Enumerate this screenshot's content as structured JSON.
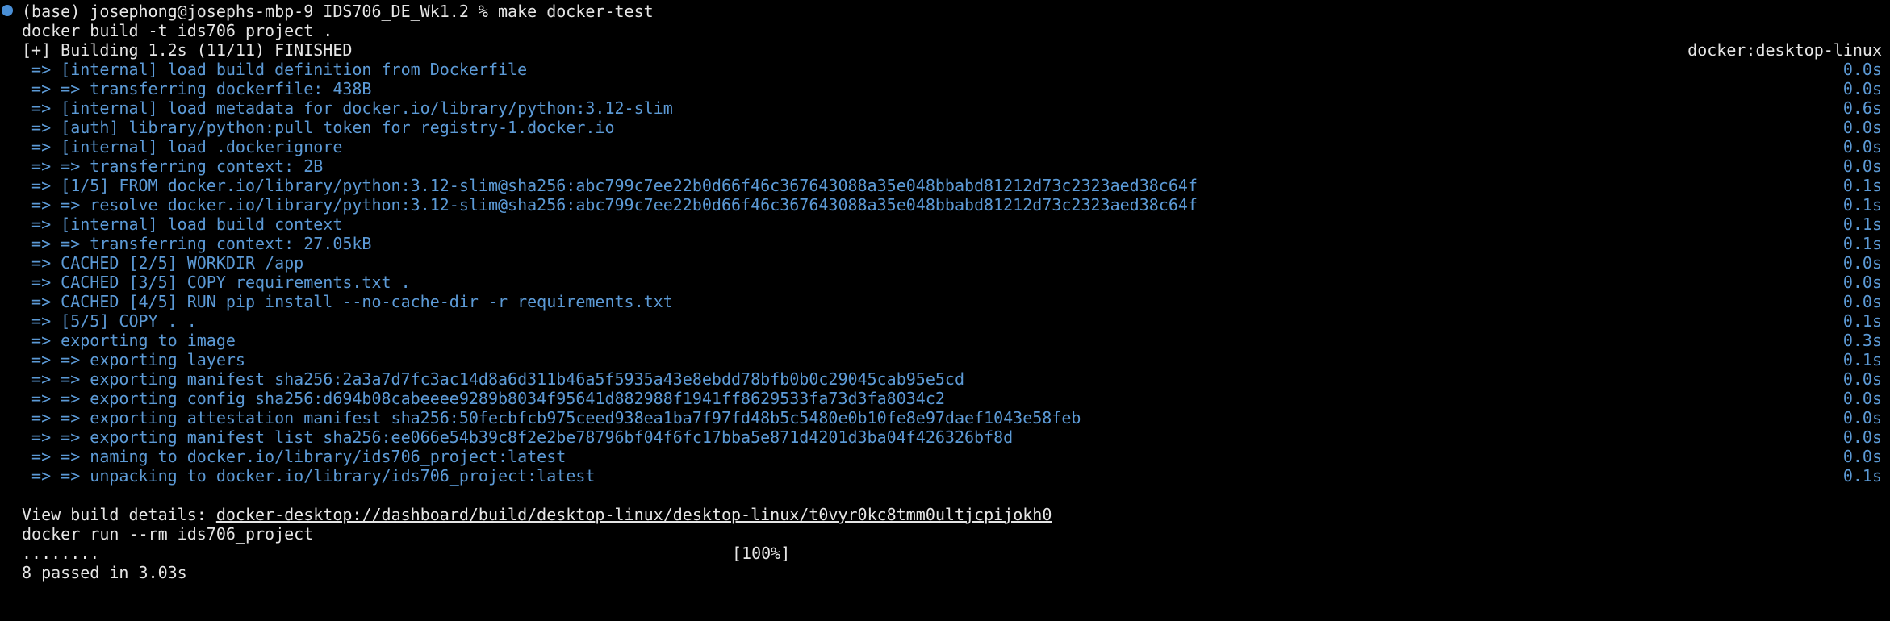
{
  "terminal": {
    "prompt": "(base) josephong@josephs-mbp-9 IDS706_DE_Wk1.2 % make docker-test",
    "build_cmd": "docker build -t ids706_project .",
    "building": "[+] Building 1.2s (11/11) FINISHED",
    "builder": "docker:desktop-linux",
    "steps": [
      {
        "text": " => [internal] load build definition from Dockerfile",
        "time": "0.0s"
      },
      {
        "text": " => => transferring dockerfile: 438B",
        "time": "0.0s"
      },
      {
        "text": " => [internal] load metadata for docker.io/library/python:3.12-slim",
        "time": "0.6s"
      },
      {
        "text": " => [auth] library/python:pull token for registry-1.docker.io",
        "time": "0.0s"
      },
      {
        "text": " => [internal] load .dockerignore",
        "time": "0.0s"
      },
      {
        "text": " => => transferring context: 2B",
        "time": "0.0s"
      },
      {
        "text": " => [1/5] FROM docker.io/library/python:3.12-slim@sha256:abc799c7ee22b0d66f46c367643088a35e048bbabd81212d73c2323aed38c64f",
        "time": "0.1s"
      },
      {
        "text": " => => resolve docker.io/library/python:3.12-slim@sha256:abc799c7ee22b0d66f46c367643088a35e048bbabd81212d73c2323aed38c64f",
        "time": "0.1s"
      },
      {
        "text": " => [internal] load build context",
        "time": "0.1s"
      },
      {
        "text": " => => transferring context: 27.05kB",
        "time": "0.1s"
      },
      {
        "text": " => CACHED [2/5] WORKDIR /app",
        "time": "0.0s"
      },
      {
        "text": " => CACHED [3/5] COPY requirements.txt .",
        "time": "0.0s"
      },
      {
        "text": " => CACHED [4/5] RUN pip install --no-cache-dir -r requirements.txt",
        "time": "0.0s"
      },
      {
        "text": " => [5/5] COPY . .",
        "time": "0.1s"
      },
      {
        "text": " => exporting to image",
        "time": "0.3s"
      },
      {
        "text": " => => exporting layers",
        "time": "0.1s"
      },
      {
        "text": " => => exporting manifest sha256:2a3a7d7fc3ac14d8a6d311b46a5f5935a43e8ebdd78bfb0b0c29045cab95e5cd",
        "time": "0.0s"
      },
      {
        "text": " => => exporting config sha256:d694b08cabeeee9289b8034f95641d882988f1941ff8629533fa73d3fa8034c2",
        "time": "0.0s"
      },
      {
        "text": " => => exporting attestation manifest sha256:50fecbfcb975ceed938ea1ba7f97fd48b5c5480e0b10fe8e97daef1043e58feb",
        "time": "0.0s"
      },
      {
        "text": " => => exporting manifest list sha256:ee066e54b39c8f2e2be78796bf04f6fc17bba5e871d4201d3ba04f426326bf8d",
        "time": "0.0s"
      },
      {
        "text": " => => naming to docker.io/library/ids706_project:latest",
        "time": "0.0s"
      },
      {
        "text": " => => unpacking to docker.io/library/ids706_project:latest",
        "time": "0.1s"
      }
    ],
    "view_label": "View build details: ",
    "view_link": "docker-desktop://dashboard/build/desktop-linux/desktop-linux/t0vyr0kc8tmm0ultjcpijokh0",
    "run_cmd": "docker run --rm ids706_project",
    "progress_dots": "........",
    "progress_pct": "[100%]",
    "summary": "8 passed in 3.03s"
  }
}
